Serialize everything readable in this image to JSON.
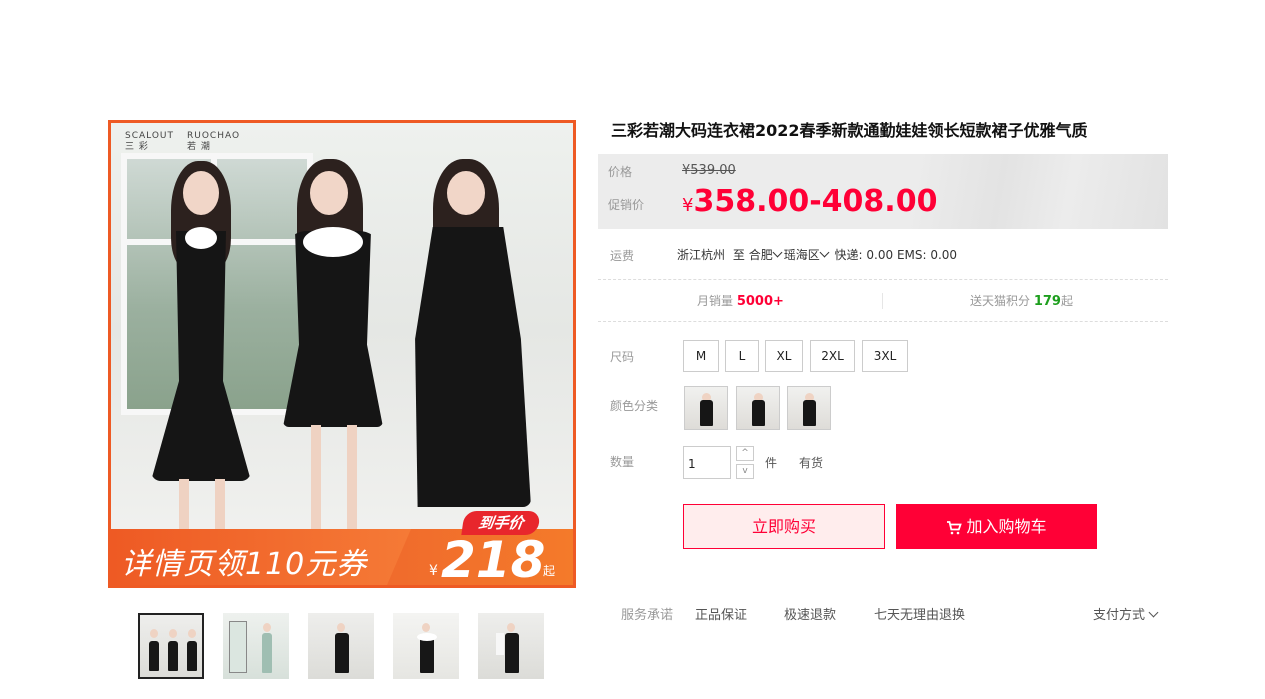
{
  "product": {
    "title": "三彩若潮大码连衣裙2022春季新款通勤娃娃领长短款裙子优雅气质"
  },
  "main_image": {
    "brand_left_top": "SCALOUT",
    "brand_left_bottom": "三 彩",
    "brand_right_top": "RUOCHAO",
    "brand_right_bottom": "若 潮",
    "banner_text": "详情页领110元券",
    "tag": "到手价",
    "currency": "¥",
    "price": "218",
    "suffix": "起"
  },
  "thumbnails": [
    "thumb-1",
    "thumb-2",
    "thumb-3",
    "thumb-4",
    "thumb-5"
  ],
  "price": {
    "original_label": "价格",
    "original_currency": "¥",
    "original_value": "539.00",
    "promo_label": "促销价",
    "promo_currency": "¥",
    "promo_value": "358.00-408.00"
  },
  "shipping": {
    "label": "运费",
    "from": "浙江杭州",
    "to_word": "至",
    "city": "合肥",
    "district": "瑶海区",
    "fees": "快递: 0.00 EMS: 0.00"
  },
  "sales": {
    "monthly_label": "月销量",
    "monthly_value": "5000+",
    "points_label": "送天猫积分",
    "points_value": "179",
    "points_suffix": "起"
  },
  "size": {
    "label": "尺码",
    "options": [
      "M",
      "L",
      "XL",
      "2XL",
      "3XL"
    ]
  },
  "color": {
    "label": "颜色分类"
  },
  "quantity": {
    "label": "数量",
    "value": "1",
    "up": "^",
    "down": "v",
    "unit": "件",
    "stock": "有货"
  },
  "actions": {
    "buy_now": "立即购买",
    "add_cart": "加入购物车"
  },
  "service": {
    "label": "服务承诺",
    "items": [
      "正品保证",
      "极速退款",
      "七天无理由退换"
    ],
    "payment": "支付方式"
  },
  "colors": {
    "accent": "#ff0036",
    "banner": "#ee5a24",
    "points": "#1d9e1d"
  }
}
